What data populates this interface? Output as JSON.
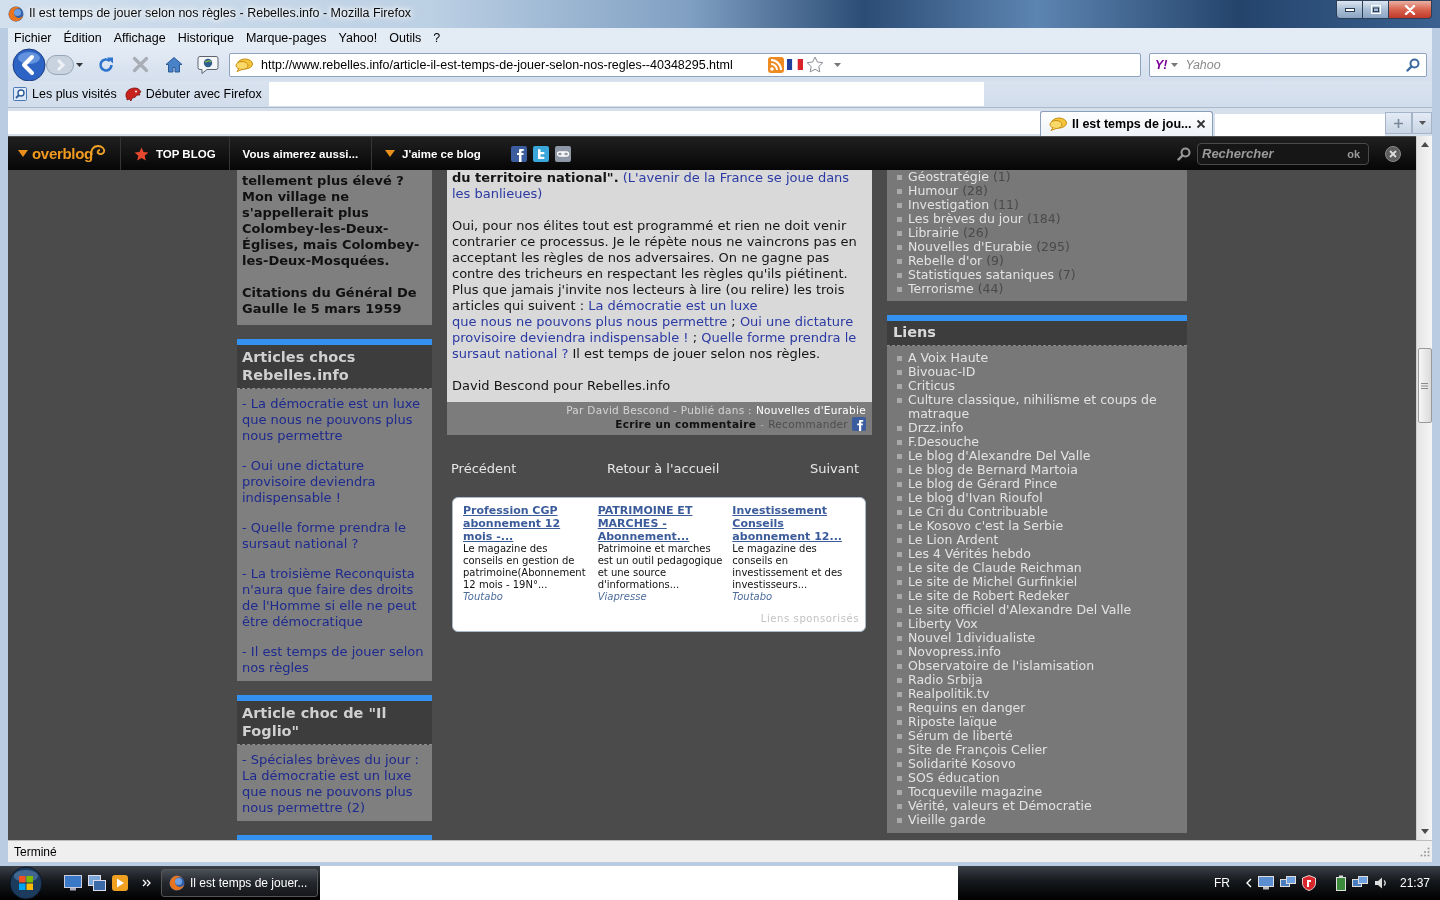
{
  "window": {
    "title": "Il est temps de jouer selon nos règles - Rebelles.info - Mozilla Firefox"
  },
  "menu": [
    "Fichier",
    "Édition",
    "Affichage",
    "Historique",
    "Marque-pages",
    "Yahoo!",
    "Outils",
    "?"
  ],
  "navigation": {
    "url": "http://www.rebelles.info/article-il-est-temps-de-jouer-selon-nos-regles--40348295.html"
  },
  "search": {
    "engine_logo": "Y!",
    "placeholder": "Yahoo"
  },
  "bookmarks": [
    {
      "label": "Les plus visités",
      "kind": "smart"
    },
    {
      "label": "Débuter avec Firefox",
      "kind": "starter"
    }
  ],
  "tabs": [
    {
      "label": "Il est temps de jou...",
      "selected": true
    }
  ],
  "overblog_bar": {
    "logo": "overblog",
    "items": [
      {
        "label": "TOP BLOG",
        "kind": "star"
      },
      {
        "label": "Vous aimerez aussi...",
        "kind": "plain"
      },
      {
        "label": "J'aime ce blog",
        "kind": "menu"
      }
    ],
    "search": {
      "placeholder": "Rechercher",
      "button": "ok"
    }
  },
  "left_column": [
    {
      "kind": "quote",
      "paragraphs": [
        "tellement plus élevé ? Mon village ne s'appellerait plus Colombey-les-Deux-Églises, mais Colombey-les-Deux-Mosquées.",
        "Citations du Général De Gaulle le 5 mars 1959"
      ]
    },
    {
      "kind": "links",
      "title": "Articles chocs Rebelles.info",
      "links": [
        "- La démocratie est un luxe que nous ne pouvons plus nous permettre",
        "- Oui une dictature provisoire deviendra indispensable !",
        "- Quelle forme prendra le sursaut national ?",
        "- La troisième Reconquista n'aura que faire des droits de l'Homme si elle ne peut être démocratique",
        "- Il est temps de jouer selon nos règles"
      ]
    },
    {
      "kind": "links",
      "title": "Article choc de \"Il Foglio\"",
      "links": [
        "- Spéciales brèves du jour : La démocratie est un luxe que nous ne pouvons plus nous permettre (2)"
      ]
    },
    {
      "kind": "stub"
    }
  ],
  "article": {
    "paragraphs": [
      [
        {
          "kind": "bold",
          "text": "du territoire national\"."
        },
        {
          "kind": "link",
          "text": "(L'avenir de la France se joue dans"
        },
        {
          "kind": "link",
          "text": "les banlieues)"
        }
      ],
      [
        {
          "kind": "text",
          "text": "Oui, pour nos élites tout est programmé et rien ne doit venir contrarier ce processus. Je le répète nous ne vaincrons pas en acceptant les règles de nos adversaires. On ne gagne pas contre des tricheurs en respectant les règles qu'ils piétinent. Plus que jamais j'invite nos lecteurs à lire (ou relire) les trois articles qui suivent :"
        },
        {
          "kind": "link",
          "text": "La démocratie est un luxe"
        },
        {
          "kind": "link",
          "text": "que nous ne pouvons plus nous permettre"
        },
        {
          "kind": "text",
          "text": ";"
        },
        {
          "kind": "link",
          "text": "Oui une dictature"
        },
        {
          "kind": "link",
          "text": "provisoire deviendra indispensable !"
        },
        {
          "kind": "text",
          "text": ";"
        },
        {
          "kind": "link",
          "text": "Quelle forme prendra le"
        },
        {
          "kind": "link",
          "text": "sursaut national ?"
        },
        {
          "kind": "text",
          "text": "Il est temps de jouer selon nos règles."
        }
      ],
      [
        {
          "kind": "text",
          "text": "David Bescond pour Rebelles.info"
        }
      ]
    ],
    "meta": {
      "byline": "Par David Bescond - Publié dans :",
      "category": "Nouvelles d'Eurabie",
      "comment": "Ecrire un commentaire",
      "separator": "-",
      "recommend": "Recommander"
    }
  },
  "article_nav": [
    "Précédent",
    "Retour à l'accueil",
    "Suivant"
  ],
  "sponsored": {
    "ads": [
      {
        "title": "Profession CGP abonnement 12 mois -...",
        "description": "Le magazine des conseils en gestion de patrimoine(Abonnement 12 mois - 19N°...",
        "source": "Toutabo"
      },
      {
        "title": "PATRIMOINE ET MARCHES - Abonnement...",
        "description": "Patrimoine et marches est un outil pedagogique et une source d'informations...",
        "source": "Viapresse"
      },
      {
        "title": "Investissement Conseils abonnement 12...",
        "description": "Le magazine des conseils en investissement et des investisseurs...",
        "source": "Toutabo"
      }
    ],
    "label": "Liens sponsorisés"
  },
  "categories": [
    {
      "name": "Géostratégie",
      "count": "(1)"
    },
    {
      "name": "Humour",
      "count": "(28)"
    },
    {
      "name": "Investigation",
      "count": "(11)"
    },
    {
      "name": "Les brèves du jour",
      "count": "(184)"
    },
    {
      "name": "Librairie",
      "count": "(26)"
    },
    {
      "name": "Nouvelles d'Eurabie",
      "count": "(295)"
    },
    {
      "name": "Rebelle d'or",
      "count": "(9)"
    },
    {
      "name": "Statistiques sataniques",
      "count": "(7)"
    },
    {
      "name": "Terrorisme",
      "count": "(44)"
    }
  ],
  "links_panel": {
    "title": "Liens",
    "items": [
      "A Voix Haute",
      "Bivouac-ID",
      "Criticus",
      "Culture classique, nihilisme et coups de matraque",
      "Drzz.info",
      "F.Desouche",
      "Le blog d'Alexandre Del Valle",
      "Le blog de Bernard Martoia",
      "Le blog de Gérard Pince",
      "Le blog d'Ivan Rioufol",
      "Le Cri du Contribuable",
      "Le Kosovo c'est la Serbie",
      "Le Lion Ardent",
      "Les 4 Vérités hebdo",
      "Le site de Claude Reichman",
      "Le site de Michel Gurfinkiel",
      "Le site de Robert Redeker",
      "Le site officiel d'Alexandre Del Valle",
      "Liberty Vox",
      "Nouvel 1dividualiste",
      "Novopress.info",
      "Observatoire de l'islamisation",
      "Radio Srbija",
      "Realpolitik.tv",
      "Requins en danger",
      "Riposte laïque",
      "Sérum de liberté",
      "Site de François Celier",
      "Solidarité Kosovo",
      "SOS éducation",
      "Tocqueville magazine",
      "Vérité, valeurs et Démocratie",
      "Vieille garde"
    ]
  },
  "status_bar": {
    "text": "Terminé"
  },
  "taskbar": {
    "task": "Il est temps de jouer...",
    "language": "FR",
    "clock": "21:37"
  }
}
